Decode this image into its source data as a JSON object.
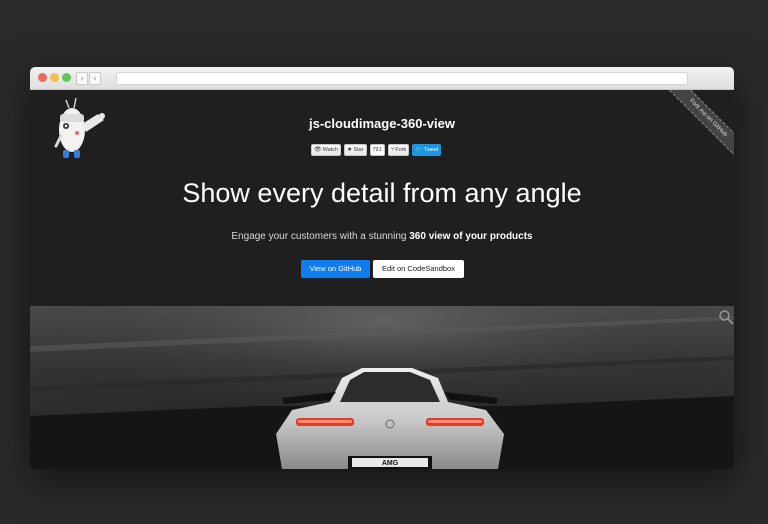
{
  "browser": {
    "back_glyph": "‹",
    "forward_glyph": "›"
  },
  "repo": {
    "title": "js-cloudimage-360-view"
  },
  "badges": {
    "watch_label": "Watch",
    "star_label": "Star",
    "star_count": "791",
    "fork_label": "Fork",
    "tweet_label": "Tweet"
  },
  "ribbon": {
    "label": "Fork me on GitHub"
  },
  "hero": {
    "headline": "Show every detail from any angle",
    "subtitle_prefix": "Engage your customers with a stunning",
    "subtitle_bold": "360 view of your products"
  },
  "buttons": {
    "github_label": "View on GitHub",
    "codesandbox_label": "Edit on CodeSandbox"
  },
  "car": {
    "plate_text": "AMG"
  },
  "colors": {
    "primary_button": "#0f7cf0",
    "tweet": "#1b95e0",
    "taillight": "#e23a2c"
  }
}
